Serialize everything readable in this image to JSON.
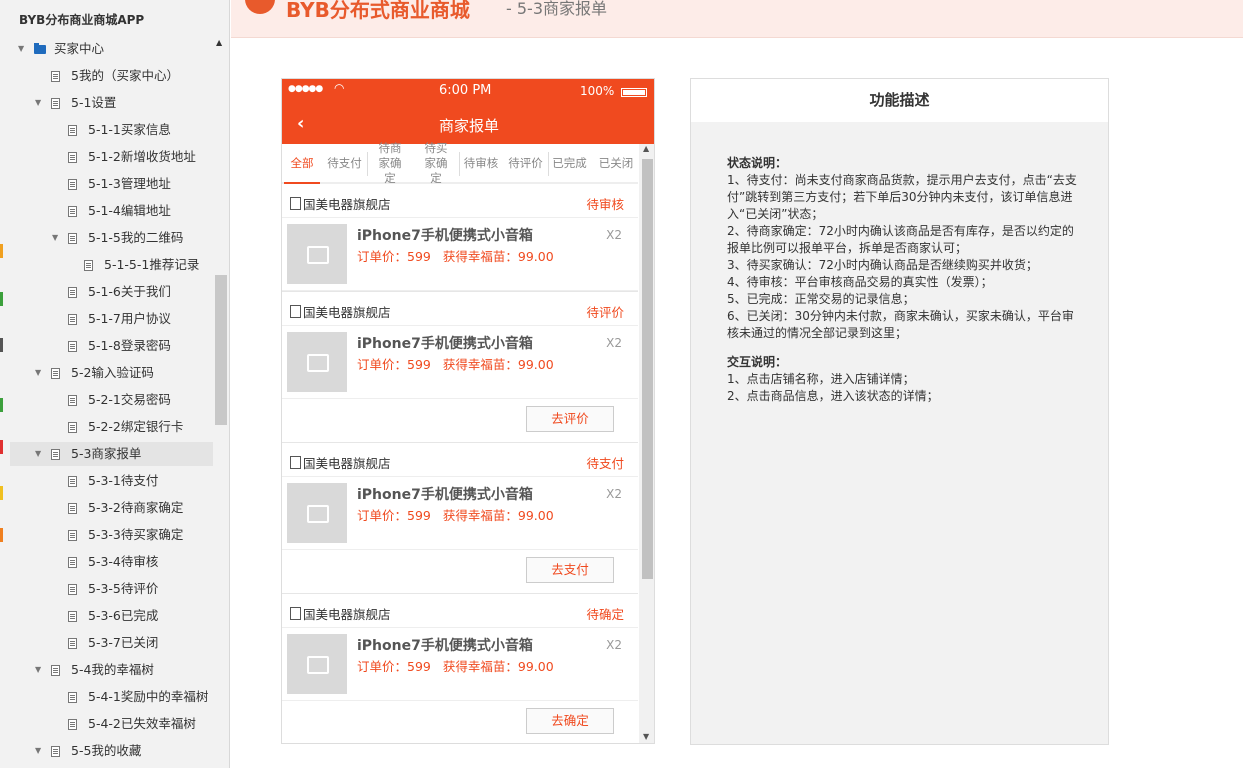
{
  "sitemap": {
    "title": "BYB分布商业商城APP",
    "items": [
      {
        "label": "买家中心",
        "level": 0,
        "type": "folder",
        "expanded": true
      },
      {
        "label": "5我的（买家中心）",
        "level": 1,
        "type": "page"
      },
      {
        "label": "5-1设置",
        "level": 1,
        "type": "page",
        "expanded": true
      },
      {
        "label": "5-1-1买家信息",
        "level": 2,
        "type": "page"
      },
      {
        "label": "5-1-2新增收货地址",
        "level": 2,
        "type": "page"
      },
      {
        "label": "5-1-3管理地址",
        "level": 2,
        "type": "page"
      },
      {
        "label": "5-1-4编辑地址",
        "level": 2,
        "type": "page"
      },
      {
        "label": "5-1-5我的二维码",
        "level": 2,
        "type": "page",
        "expanded": true
      },
      {
        "label": "5-1-5-1推荐记录",
        "level": 3,
        "type": "page"
      },
      {
        "label": "5-1-6关于我们",
        "level": 2,
        "type": "page"
      },
      {
        "label": "5-1-7用户协议",
        "level": 2,
        "type": "page"
      },
      {
        "label": "5-1-8登录密码",
        "level": 2,
        "type": "page"
      },
      {
        "label": "5-2输入验证码",
        "level": 1,
        "type": "page",
        "expanded": true
      },
      {
        "label": "5-2-1交易密码",
        "level": 2,
        "type": "page"
      },
      {
        "label": "5-2-2绑定银行卡",
        "level": 2,
        "type": "page"
      },
      {
        "label": "5-3商家报单",
        "level": 1,
        "type": "page",
        "expanded": true,
        "selected": true
      },
      {
        "label": "5-3-1待支付",
        "level": 2,
        "type": "page"
      },
      {
        "label": "5-3-2待商家确定",
        "level": 2,
        "type": "page"
      },
      {
        "label": "5-3-3待买家确定",
        "level": 2,
        "type": "page"
      },
      {
        "label": "5-3-4待审核",
        "level": 2,
        "type": "page"
      },
      {
        "label": "5-3-5待评价",
        "level": 2,
        "type": "page"
      },
      {
        "label": "5-3-6已完成",
        "level": 2,
        "type": "page"
      },
      {
        "label": "5-3-7已关闭",
        "level": 2,
        "type": "page"
      },
      {
        "label": "5-4我的幸福树",
        "level": 1,
        "type": "page",
        "expanded": true
      },
      {
        "label": "5-4-1奖励中的幸福树",
        "level": 2,
        "type": "page"
      },
      {
        "label": "5-4-2已失效幸福树",
        "level": 2,
        "type": "page"
      },
      {
        "label": "5-5我的收藏",
        "level": 1,
        "type": "page",
        "expanded": true
      }
    ]
  },
  "header": {
    "logo_text": "BYB分布式商业商城",
    "page_subtitle": "- 5-3商家报单"
  },
  "phone": {
    "status": {
      "time": "6:00 PM",
      "battery": "100%"
    },
    "nav_title": "商家报单",
    "tabs": [
      {
        "label": "全部",
        "active": true
      },
      {
        "label": "待支付"
      },
      {
        "label": "待商家确定"
      },
      {
        "label": "待买家确定"
      },
      {
        "label": "待审核"
      },
      {
        "label": "待评价"
      },
      {
        "label": "已完成"
      },
      {
        "label": "已关闭"
      }
    ],
    "orders": [
      {
        "shop": "国美电器旗舰店",
        "state": "待审核",
        "product": "iPhone7手机便携式小音箱",
        "qty": "X2",
        "price": "订单价：599",
        "reward": "获得幸福苗：99.00",
        "action": ""
      },
      {
        "shop": "国美电器旗舰店",
        "state": "待评价",
        "product": "iPhone7手机便携式小音箱",
        "qty": "X2",
        "price": "订单价：599",
        "reward": "获得幸福苗：99.00",
        "action": "去评价"
      },
      {
        "shop": "国美电器旗舰店",
        "state": "待支付",
        "product": "iPhone7手机便携式小音箱",
        "qty": "X2",
        "price": "订单价：599",
        "reward": "获得幸福苗：99.00",
        "action": "去支付"
      },
      {
        "shop": "国美电器旗舰店",
        "state": "待确定",
        "product": "iPhone7手机便携式小音箱",
        "qty": "X2",
        "price": "订单价：599",
        "reward": "获得幸福苗：99.00",
        "action": "去确定"
      }
    ]
  },
  "description": {
    "title": "功能描述",
    "status_heading": "状态说明：",
    "status_lines": [
      "1、待支付：尚未支付商家商品货款，提示用户去支付，点击“去支付”跳转到第三方支付；若下单后30分钟内未支付，该订单信息进入“已关闭”状态；",
      "2、待商家确定：72小时内确认该商品是否有库存，是否以约定的报单比例可以报单平台，拆单是否商家认可；",
      "3、待买家确认：72小时内确认商品是否继续购买并收货；",
      "4、待审核：平台审核商品交易的真实性（发票）；",
      "5、已完成：正常交易的记录信息；",
      "6、已关闭：30分钟内未付款，商家未确认，买家未确认，平台审核未通过的情况全部记录到这里；"
    ],
    "interaction_heading": "交互说明：",
    "interaction_lines": [
      "1、点击店铺名称，进入店铺详情；",
      "2、点击商品信息，进入该状态的详情；"
    ]
  }
}
